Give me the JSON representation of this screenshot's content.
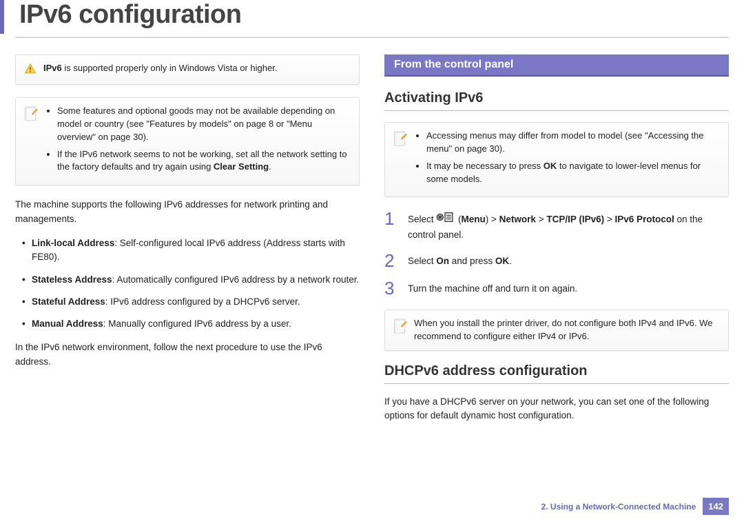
{
  "title": "IPv6 configuration",
  "left": {
    "warn_html": "<b>IPv6</b> is supported properly only in Windows Vista or higher.",
    "note_items_html": [
      "Some features and optional goods may not be available depending on model or country (see \"Features by models\" on page 8 or \"Menu overview\" on page 30).",
      "If the IPv6 network seems to not be working, set all the network setting to the factory defaults and try again using <b>Clear Setting</b>."
    ],
    "intro": "The machine supports the following IPv6 addresses for network printing and managements.",
    "addresses_html": [
      "<b>Link-local Address</b>: Self-configured local IPv6 address (Address starts with FE80).",
      "<b>Stateless Address</b>: Automatically configured IPv6 address by a network router.",
      "<b>Stateful Address</b>: IPv6 address configured by a DHCPv6 server.",
      "<b>Manual Address</b>: Manually configured IPv6 address by a user."
    ],
    "outro": "In the IPv6 network environment, follow the next procedure to use the IPv6 address."
  },
  "right": {
    "section_bar": "From the control panel",
    "heading1": "Activating IPv6",
    "note1_items_html": [
      "Accessing menus may differ from model to model (see \"Accessing the menu\" on page 30).",
      "It may be necessary to press <b>OK</b> to navigate to lower-level menus for some models."
    ],
    "steps": [
      {
        "num": "1",
        "html": "Select {MENU_ICON} (<b>Menu</b>) > <b>Network</b> > <b>TCP/IP (IPv6)</b> > <b>IPv6 Protocol</b> on the control panel."
      },
      {
        "num": "2",
        "html": "Select <b>On</b> and press <b>OK</b>."
      },
      {
        "num": "3",
        "html": "Turn the machine off and turn it on again."
      }
    ],
    "note2_html": "When you install the printer driver, do not configure both IPv4 and IPv6. We recommend to configure either IPv4 or IPv6.",
    "heading2": "DHCPv6 address configuration",
    "para2": "If you have a DHCPv6 server on your network, you can set one of the following options for default dynamic host configuration."
  },
  "footer": {
    "chapter": "2.  Using a Network-Connected Machine",
    "page": "142"
  }
}
